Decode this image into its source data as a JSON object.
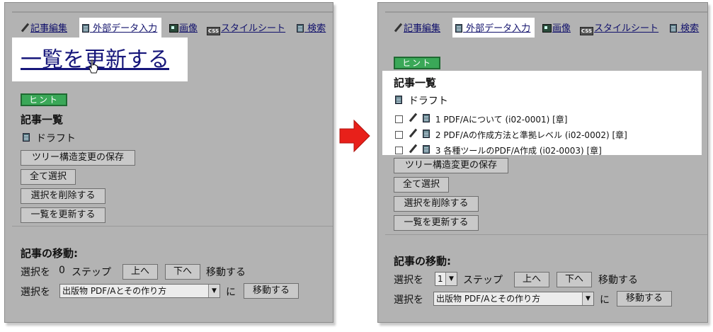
{
  "tabs": [
    {
      "label": "記事編集",
      "icon": "pencil-icon"
    },
    {
      "label": "外部データ入力",
      "icon": "document-icon"
    },
    {
      "label": "画像",
      "icon": "image-icon"
    },
    {
      "label": "スタイルシート",
      "icon": "css-icon",
      "icon_text": "CSS"
    },
    {
      "label": "検索",
      "icon": "document-icon"
    }
  ],
  "left": {
    "big_link": "一覧を更新する",
    "hint": "ヒント",
    "heading": "記事一覧",
    "draft": "ドラフト",
    "buttons": {
      "save_tree": "ツリー構造変更の保存",
      "select_all": "全て選択",
      "delete_selected": "選択を削除する",
      "refresh": "一覧を更新する"
    },
    "move": {
      "heading": "記事の移動:",
      "line1_prefix": "選択を",
      "step_value": "0",
      "step_label": "ステップ",
      "up": "上へ",
      "down": "下へ",
      "move_suffix": "移動する",
      "line2_prefix": "選択を",
      "target": "出版物 PDF/Aとその作り方",
      "ni": "に",
      "move_button": "移動する"
    }
  },
  "right": {
    "hint": "ヒント",
    "heading": "記事一覧",
    "draft": "ドラフト",
    "articles": [
      "1 PDF/Aについて (i02-0001) [章]",
      "2 PDF/Aの作成方法と準拠レベル (i02-0002) [章]",
      "3 各種ツールのPDF/A作成 (i02-0003) [章]"
    ],
    "buttons": {
      "save_tree": "ツリー構造変更の保存",
      "select_all": "全て選択",
      "delete_selected": "選択を削除する",
      "refresh": "一覧を更新する"
    },
    "move": {
      "heading": "記事の移動:",
      "line1_prefix": "選択を",
      "step_value": "1",
      "step_label": "ステップ",
      "up": "上へ",
      "down": "下へ",
      "move_suffix": "移動する",
      "line2_prefix": "選択を",
      "target": "出版物 PDF/Aとその作り方",
      "ni": "に",
      "move_button": "移動する"
    }
  },
  "colors": {
    "panel": "#b3b3b3",
    "hint": "#3aa858",
    "link": "#16167a",
    "arrow": "#e8201a"
  }
}
